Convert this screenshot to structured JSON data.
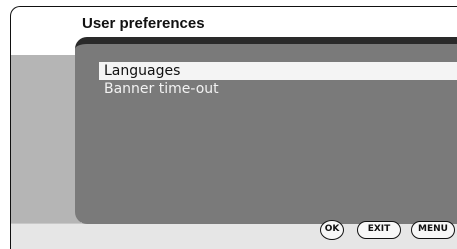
{
  "header": {
    "title": "User preferences"
  },
  "menu": {
    "items": [
      {
        "label": "Languages",
        "selected": true
      },
      {
        "label": "Banner time-out",
        "selected": false
      }
    ]
  },
  "buttons": {
    "ok": "OK",
    "exit": "EXIT",
    "menu": "MENU"
  }
}
